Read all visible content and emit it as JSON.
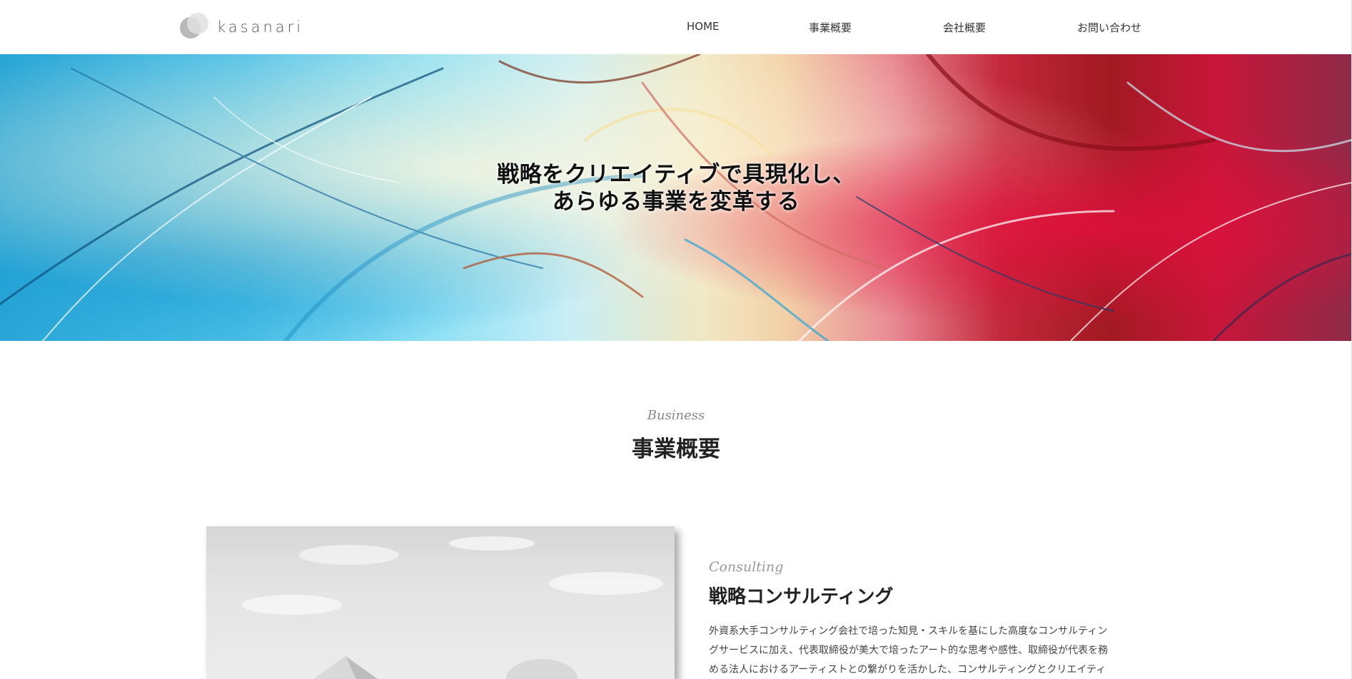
{
  "header": {
    "logo_text": "kasanari",
    "nav": [
      "HOME",
      "事業概要",
      "会社概要",
      "お問い合わせ"
    ]
  },
  "hero": {
    "line1": "戦略をクリエイティブで具現化し、",
    "line2": "あらゆる事業を変革する"
  },
  "business": {
    "en": "Business",
    "ja": "事業概要"
  },
  "consulting": {
    "en": "Consulting",
    "ja": "戦略コンサルティング",
    "body": "外資系大手コンサルティング会社で培った知見・スキルを基にした高度なコンサルティングサービスに加え、代表取締役が美大で培ったアート的な思考や感性、取締役が代表を務める法人におけるアーティストとの繋がりを活かした、コンサルティングとクリエイティブを融合したサービスを提供"
  },
  "colors": {
    "text": "#222222",
    "muted": "#888888",
    "hero_blue": "#4cc0e8",
    "hero_red": "#c4283c"
  }
}
